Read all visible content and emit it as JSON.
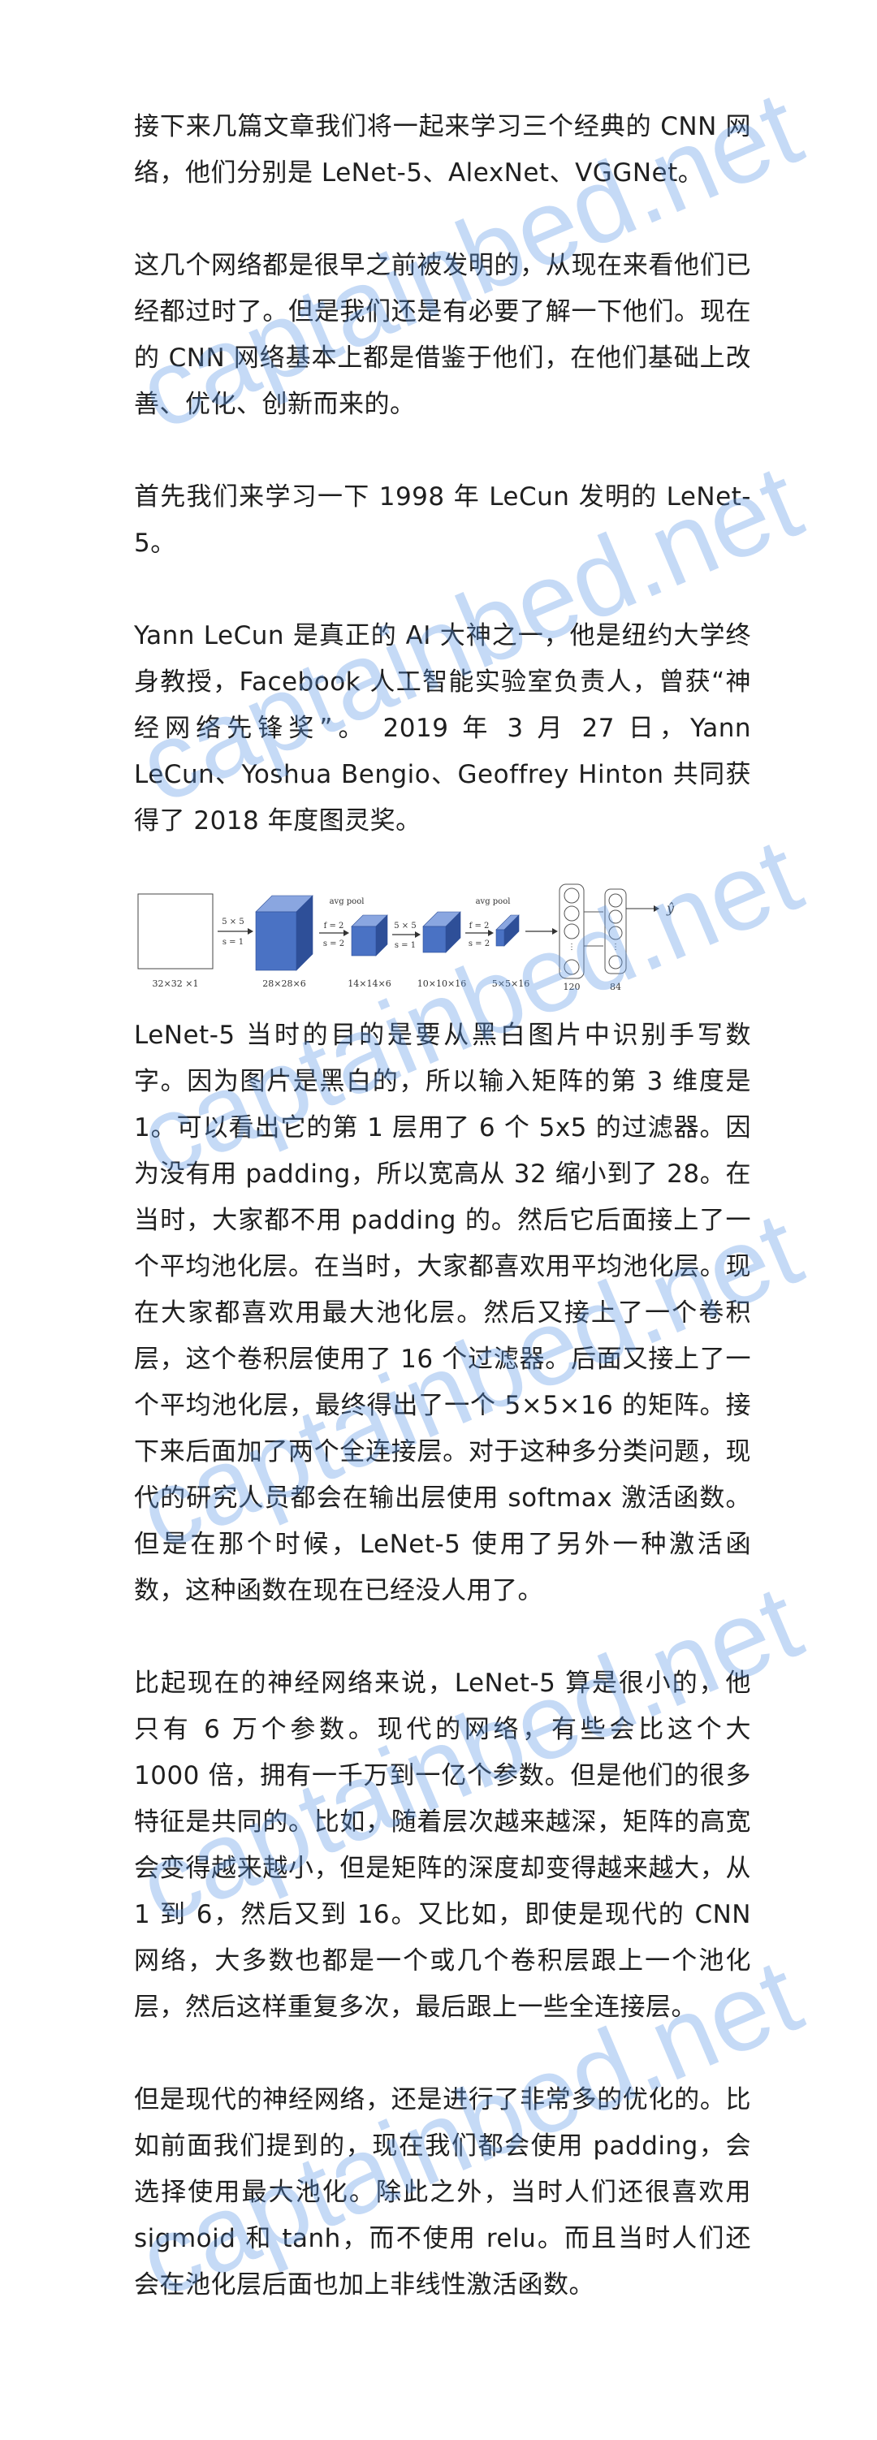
{
  "paragraphs": [
    "接下来几篇文章我们将一起来学习三个经典的 CNN 网络，他们分别是 LeNet-5、AlexNet、VGGNet。",
    "这几个网络都是很早之前被发明的，从现在来看他们已经都过时了。但是我们还是有必要了解一下他们。现在的 CNN 网络基本上都是借鉴于他们，在他们基础上改善、优化、创新而来的。",
    "首先我们来学习一下 1998 年 LeCun 发明的 LeNet-5。",
    "Yann LeCun 是真正的 AI 大神之一，他是纽约大学终身教授，Facebook 人工智能实验室负责人，曾获“神经网络先锋奖”。 2019 年 3 月 27 日，Yann LeCun、Yoshua Bengio、Geoffrey Hinton 共同获得了 2018 年度图灵奖。",
    "LeNet-5 当时的目的是要从黑白图片中识别手写数字。因为图片是黑白的，所以输入矩阵的第 3 维度是 1。可以看出它的第 1 层用了 6 个 5x5 的过滤器。因为没有用 padding，所以宽高从 32 缩小到了 28。在当时，大家都不用 padding 的。然后它后面接上了一个平均池化层。在当时，大家都喜欢用平均池化层。现在大家都喜欢用最大池化层。然后又接上了一个卷积层，这个卷积层使用了 16 个过滤器。后面又接上了一个平均池化层，最终得出了一个 5×5×16 的矩阵。接下来后面加了两个全连接层。对于这种多分类问题，现代的研究人员都会在输出层使用 softmax 激活函数。但是在那个时候，LeNet-5 使用了另外一种激活函数，这种函数在现在已经没人用了。",
    "比起现在的神经网络来说，LeNet-5 算是很小的，他只有 6 万个参数。现代的网络，有些会比这个大 1000 倍，拥有一千万到一亿个参数。但是他们的很多特征是共同的。比如，随着层次越来越深，矩阵的高宽会变得越来越小，但是矩阵的深度却变得越来越大，从 1 到 6，然后又到 16。又比如，即使是现代的 CNN 网络，大多数也都是一个或几个卷积层跟上一个池化层，然后这样重复多次，最后跟上一些全连接层。",
    "但是现代的神经网络，还是进行了非常多的优化的。比如前面我们提到的，现在我们都会使用 padding，会选择使用最大池化。除此之外，当时人们还很喜欢用 sigmoid 和 tanh，而不使用 relu。而且当时人们还会在池化层后面也加上非线性激活函数。"
  ],
  "figure": {
    "input_label": "32×32 ×1",
    "conv1_op": [
      "5 × 5",
      "s = 1"
    ],
    "conv1_label": "28×28×6",
    "pool1_title": "avg pool",
    "pool1_op": [
      "f = 2",
      "s = 2"
    ],
    "pool1_label": "14×14×6",
    "conv2_op": [
      "5 × 5",
      "s = 1"
    ],
    "conv2_label": "10×10×16",
    "pool2_title": "avg pool",
    "pool2_op": [
      "f = 2",
      "s = 2"
    ],
    "pool2_label": "5×5×16",
    "fc1_label": "120",
    "fc2_label": "84",
    "output_label": "ŷ",
    "box_color": "#4a72c4",
    "box_dark": "#2e4f98",
    "box_light": "#8aa6e0"
  },
  "watermark": "captainbed.net"
}
